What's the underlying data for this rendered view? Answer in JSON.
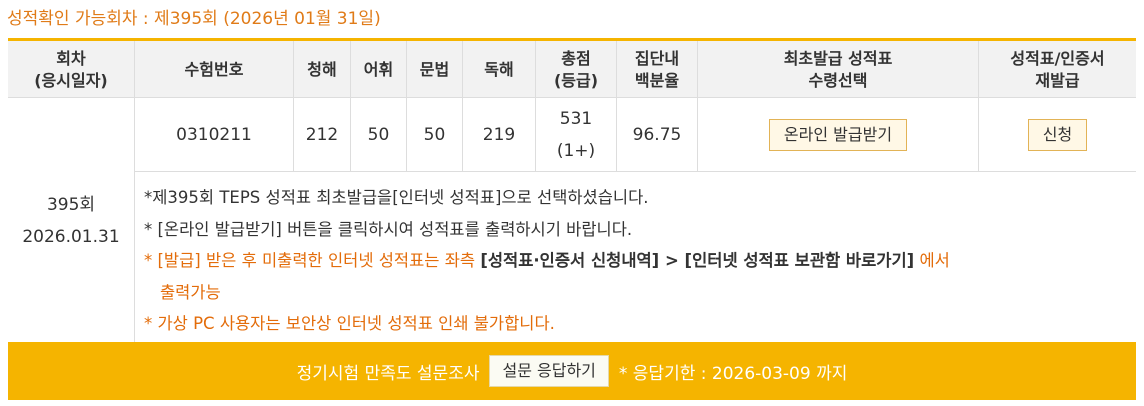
{
  "heading": "성적확인 가능회차 : 제395회 (2026년 01월 31일)",
  "table": {
    "headers": {
      "round": "회차\n(응시일자)",
      "exam_no": "수험번호",
      "listening": "청해",
      "vocab": "어휘",
      "grammar": "문법",
      "reading": "독해",
      "total": "총점\n(등급)",
      "percentile": "집단내\n백분율",
      "first_issue": "최초발급 성적표\n수령선택",
      "reissue": "성적표/인증서\n재발급"
    },
    "row": {
      "round": "395회\n2026.01.31",
      "exam_no": "0310211",
      "listening": "212",
      "vocab": "50",
      "grammar": "50",
      "reading": "219",
      "total": "531\n(1+)",
      "percentile": "96.75",
      "issue_button": "온라인 발급받기",
      "reissue_button": "신청"
    }
  },
  "notes": {
    "n1": "*제395회 TEPS 성적표 최초발급을[인터넷 성적표]으로 선택하셨습니다.",
    "n2": "* [온라인 발급받기] 버튼을 클릭하시여 성적표를 출력하시기 바랍니다.",
    "n3_a": "* [발급] 받은 후 미출력한 인터넷 성적표는 좌측 ",
    "n3_b": "[성적표·인증서 신청내역] > [인터넷 성적표 보관함 바로가기]",
    "n3_c": " 에서",
    "n3_d": "출력가능",
    "n4": "* 가상 PC 사용자는 보안상 인터넷 성적표 인쇄 불가합니다."
  },
  "footer": {
    "text": "정기시험 만족도 설문조사",
    "button": "설문 응답하기",
    "deadline": "* 응답기한 : 2026-03-09 까지"
  },
  "colors": {
    "accent": "#f5b400",
    "heading": "#e07b18",
    "notice": "#e36c0a"
  }
}
